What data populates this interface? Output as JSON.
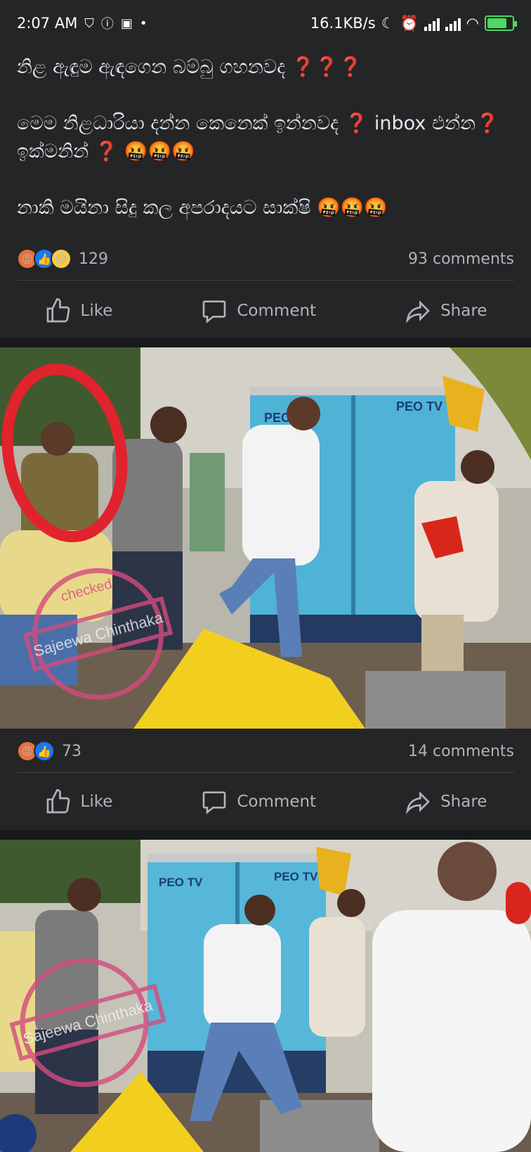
{
  "status_bar": {
    "time": "2:07 AM",
    "speed": "16.1KB/s",
    "battery_level": 0.8
  },
  "post1": {
    "lines": [
      "නිළ ඇඳුම ඇඳගෙන බම්බු ගහනවද ❓❓❓",
      "මෙම නිළධාරියා දන්න කෙනෙක් ඉන්නවද ❓ inbox එන්න❓ ඉක්මනින් ❓ 🤬🤬🤬",
      "නාකි මයිනා සිදු කල අපරාදයට සාක්ෂි 🤬🤬🤬"
    ],
    "reaction_count": "129",
    "comments": "93 comments"
  },
  "post2": {
    "reaction_count": "73",
    "comments": "14 comments",
    "watermark": "Sajeewa Chinthaka",
    "stamp_top": "checked",
    "sign_1": "PEO TV",
    "sign_2": "PEO TV"
  },
  "post3": {
    "watermark": "Sajeewa Chinthaka",
    "sign_1": "PEO TV",
    "sign_2": "PEO TV"
  },
  "actions": {
    "like": "Like",
    "comment": "Comment",
    "share": "Share"
  },
  "colors": {
    "background": "#242526",
    "text": "#e4e6eb",
    "muted": "#b0b3b8",
    "like_blue": "#1877f2",
    "battery_green": "#4cd964"
  }
}
